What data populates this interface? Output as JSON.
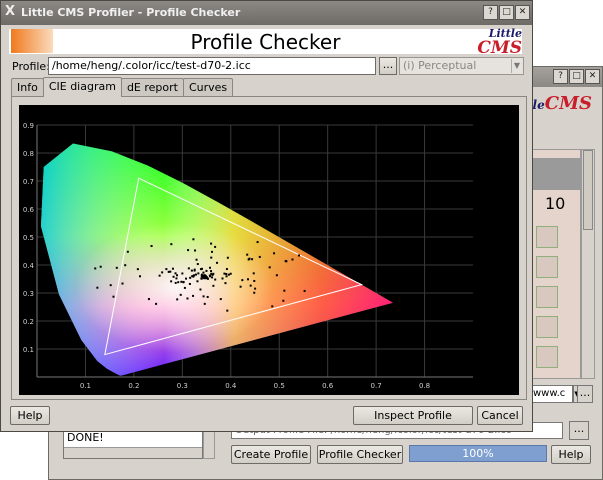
{
  "main_window": {
    "title": "Little CMS Profiler - Profile Checker",
    "title_icon": "X",
    "controls": [
      "?",
      "□",
      "✕"
    ],
    "header": {
      "title": "Profile Checker",
      "logo_little": "Little",
      "logo_cms": "CMS"
    },
    "profile_label": "Profile:",
    "profile_path": "/home/heng/.color/icc/test-d70-2.icc",
    "browse_label": "...",
    "intent_value": "(i) Perceptual",
    "tabs": [
      {
        "label": "Info",
        "active": false
      },
      {
        "label": "CIE diagram",
        "active": true
      },
      {
        "label": "dE report",
        "active": false
      },
      {
        "label": "Curves",
        "active": false
      }
    ],
    "buttons": {
      "help": "Help",
      "inspect": "Inspect Profile",
      "cancel": "Cancel"
    }
  },
  "background_window": {
    "controls": [
      "?",
      "□",
      "✕"
    ],
    "logo_little": "Little",
    "logo_cms": "CMS",
    "panel_number": "10",
    "combo_value": "www.c",
    "dots_label": "...",
    "log_line": "DONE!",
    "output_file_text": "Output Profile File: /home/heng/.color/icc/test-d70-2.icc",
    "buttons": {
      "create": "Create Profile",
      "checker": "Profile Checker",
      "help": "Help"
    },
    "progress_text": "100%",
    "progress_value": 100
  },
  "chart_data": {
    "type": "scatter",
    "title": "",
    "xlabel": "",
    "ylabel": "",
    "xlim": [
      0,
      0.9
    ],
    "ylim": [
      0,
      0.9
    ],
    "x_ticks": [
      "0.1",
      "0.2",
      "0.3",
      "0.4",
      "0.5",
      "0.6",
      "0.7",
      "0.8"
    ],
    "y_ticks": [
      "0.1",
      "0.2",
      "0.3",
      "0.4",
      "0.5",
      "0.6",
      "0.7",
      "0.8",
      "0.9"
    ],
    "grid": true,
    "background": "#000000",
    "spectral_locus": [
      [
        0.1741,
        0.005
      ],
      [
        0.1738,
        0.0049
      ],
      [
        0.173,
        0.0048
      ],
      [
        0.1714,
        0.0051
      ],
      [
        0.1689,
        0.0069
      ],
      [
        0.1644,
        0.0109
      ],
      [
        0.1566,
        0.0177
      ],
      [
        0.144,
        0.0297
      ],
      [
        0.1241,
        0.0578
      ],
      [
        0.0913,
        0.1327
      ],
      [
        0.0454,
        0.295
      ],
      [
        0.0082,
        0.5384
      ],
      [
        0.0139,
        0.7502
      ],
      [
        0.0743,
        0.8338
      ],
      [
        0.1547,
        0.8059
      ],
      [
        0.2296,
        0.7543
      ],
      [
        0.3016,
        0.6923
      ],
      [
        0.3731,
        0.6245
      ],
      [
        0.4441,
        0.5547
      ],
      [
        0.5125,
        0.4866
      ],
      [
        0.5752,
        0.4242
      ],
      [
        0.627,
        0.3725
      ],
      [
        0.6658,
        0.334
      ],
      [
        0.6915,
        0.3083
      ],
      [
        0.7079,
        0.292
      ],
      [
        0.7347,
        0.2653
      ]
    ],
    "gamut_triangle": [
      [
        0.67,
        0.33
      ],
      [
        0.21,
        0.71
      ],
      [
        0.14,
        0.08
      ]
    ],
    "white_point": [
      0.3457,
      0.3585
    ],
    "measured_points_note": "cloud of sample points around white point"
  }
}
